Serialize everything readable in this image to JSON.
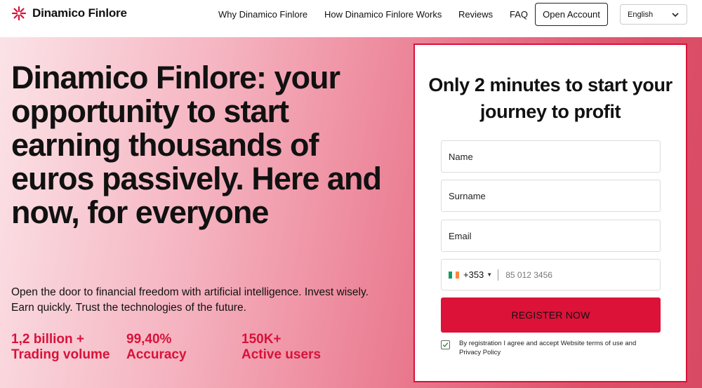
{
  "header": {
    "brand": "Dinamico Finlore",
    "logo_icon": "starburst-icon",
    "nav": {
      "why": "Why Dinamico Finlore",
      "how": "How Dinamico Finlore Works",
      "reviews": "Reviews",
      "faq": "FAQ"
    },
    "open_account": "Open Account",
    "language": "English",
    "language_icon": "chevron-down-icon"
  },
  "hero": {
    "title": "Dinamico Finlore: your opportunity to start earning thousands of euros passively. Here and now, for everyone",
    "subtitle": "Open the door to financial freedom with artificial intelligence. Invest wisely. Earn quickly. Trust the technologies of the future.",
    "stats": [
      {
        "value": "1,2 billion +",
        "label": "Trading volume"
      },
      {
        "value": "99,40%",
        "label": "Accuracy"
      },
      {
        "value": "150K+",
        "label": "Active users"
      }
    ]
  },
  "form": {
    "title": "Only 2 minutes to start your journey to profit",
    "name_placeholder": "Name",
    "surname_placeholder": "Surname",
    "email_placeholder": "Email",
    "phone_code": "+353",
    "phone_placeholder": "85 012 3456",
    "phone_flag": "ireland-flag-icon",
    "register_label": "REGISTER NOW",
    "consent": "By registration I agree and accept Website terms of use and Privacy Policy",
    "consent_checked": true
  },
  "colors": {
    "accent": "#dc1239",
    "stat_red": "#d8123a",
    "hero_gradient_start": "#fbe3e7",
    "hero_gradient_end": "#d84a63"
  }
}
